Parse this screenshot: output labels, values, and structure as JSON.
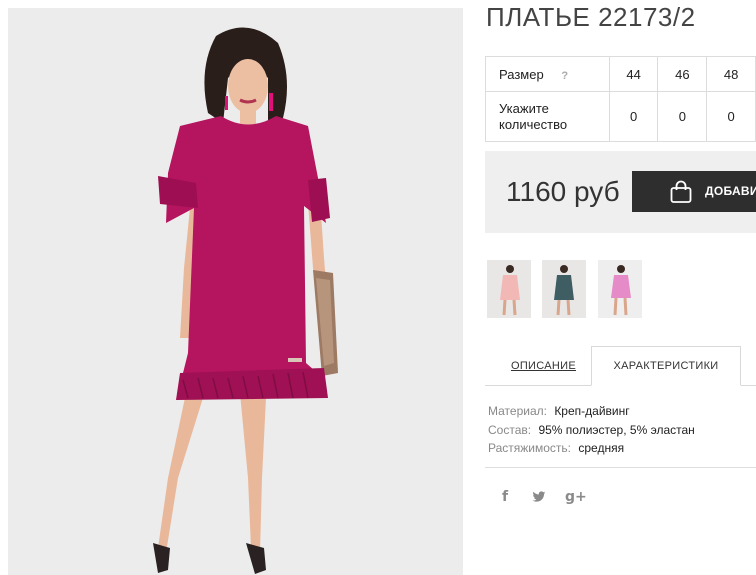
{
  "product": {
    "title": "ПЛАТЬЕ 22173/2",
    "price": "1160 руб",
    "add_to_cart_label": "ДОБАВИТЬ"
  },
  "size_table": {
    "size_label": "Размер",
    "help_icon": "?",
    "sizes": [
      "44",
      "46",
      "48"
    ],
    "quantity_label_line1": "Укажите",
    "quantity_label_line2": "количество",
    "quantities": [
      "0",
      "0",
      "0"
    ]
  },
  "thumbnails": [
    {
      "name": "pink-dress-thumbnail",
      "dress_color": "#f2b8b5"
    },
    {
      "name": "teal-dress-thumbnail",
      "dress_color": "#3e5e63"
    },
    {
      "name": "light-pink-dress-thumbnail",
      "dress_color": "#e58bc8"
    }
  ],
  "tabs": {
    "description": "ОПИСАНИЕ",
    "characteristics": "ХАРАКТЕРИСТИКИ",
    "active": "characteristics"
  },
  "specs": [
    {
      "key": "Материал:",
      "value": "Креп-дайвинг"
    },
    {
      "key": "Состав:",
      "value": "95% полиэстер, 5% эластан"
    },
    {
      "key": "Растяжимость:",
      "value": "средняя"
    }
  ],
  "social": {
    "facebook": "f",
    "twitter": "🐦",
    "google_plus": "g+"
  },
  "colors": {
    "dress": "#b5145f",
    "button_bg": "#2e2e2e",
    "price_box_bg": "#efefef"
  },
  "icons": [
    "shopping-bag-icon",
    "facebook-icon",
    "twitter-icon",
    "google-plus-icon"
  ]
}
